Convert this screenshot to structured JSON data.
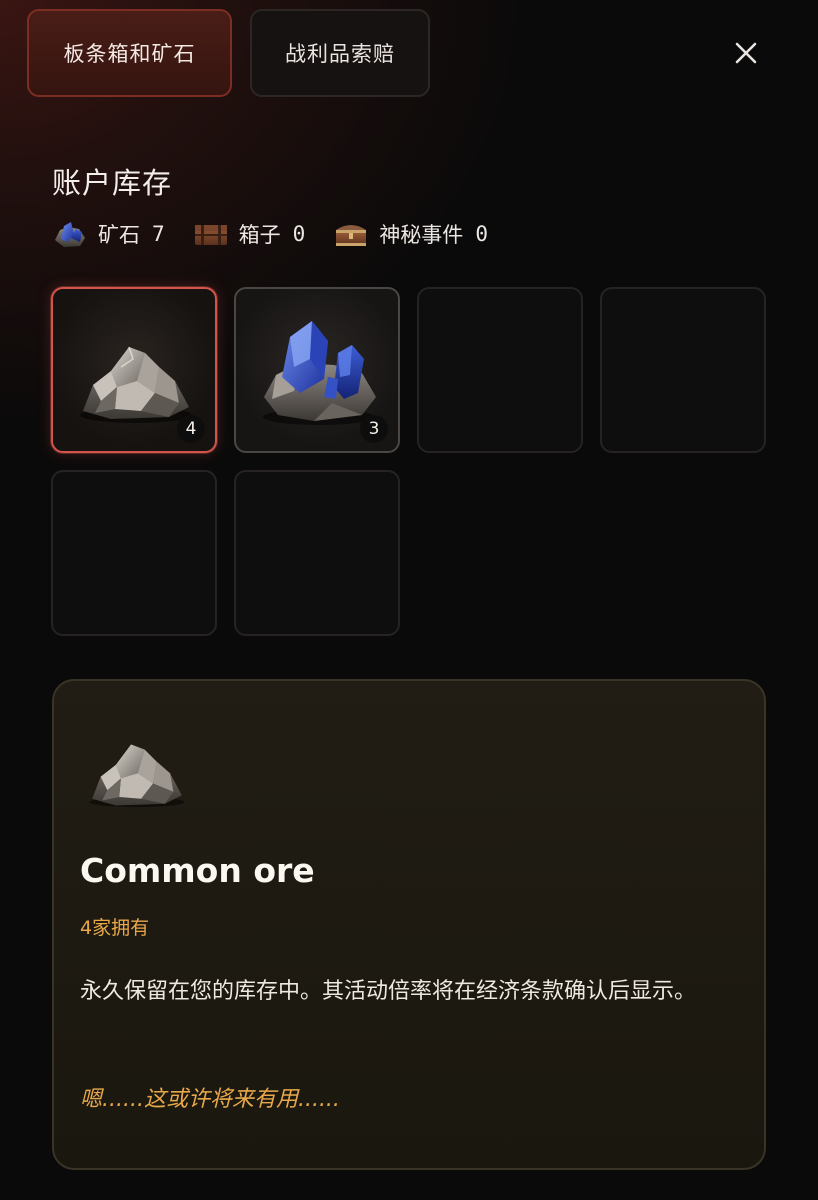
{
  "tabs": [
    {
      "label": "板条箱和矿石",
      "active": true
    },
    {
      "label": "战利品索赔",
      "active": false
    }
  ],
  "close_icon": "close-icon",
  "section_title": "账户库存",
  "stats": [
    {
      "icon": "blue-ore-icon",
      "label": "矿石",
      "value": "7"
    },
    {
      "icon": "box-icon",
      "label": "箱子",
      "value": "0"
    },
    {
      "icon": "mystery-chest-icon",
      "label": "神秘事件",
      "value": "0"
    }
  ],
  "inventory_slots": [
    {
      "item": "common-ore",
      "count": "4",
      "selected": true
    },
    {
      "item": "blue-ore",
      "count": "3",
      "selected": false
    },
    {
      "item": null
    },
    {
      "item": null
    },
    {
      "item": null
    },
    {
      "item": null
    }
  ],
  "detail": {
    "name": "Common ore",
    "owned": "4家拥有",
    "description": "永久保留在您的库存中。其活动倍率将在经济条款确认后显示。",
    "flavor": "嗯......这或许将来有用......"
  },
  "colors": {
    "accent_red": "#d2544a",
    "accent_gold": "#e8a84a",
    "background": "#0b0a0a"
  }
}
